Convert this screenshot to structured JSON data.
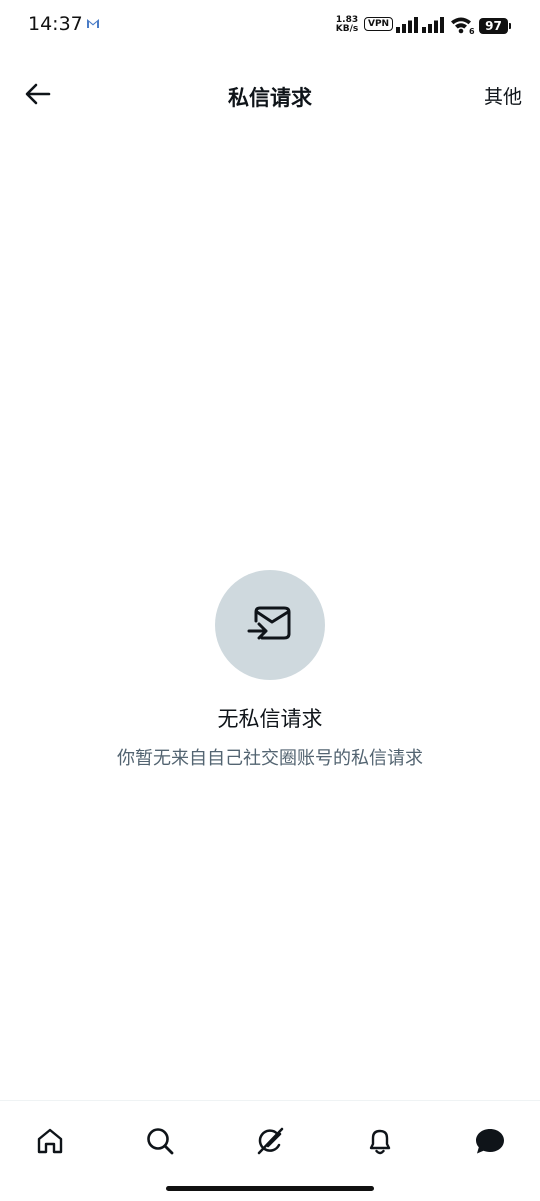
{
  "status_bar": {
    "time": "14:37",
    "net_speed_value": "1.83",
    "net_speed_unit": "KB/s",
    "vpn": "VPN",
    "battery": "97"
  },
  "header": {
    "title": "私信请求",
    "more_label": "其他"
  },
  "empty_state": {
    "title": "无私信请求",
    "subtitle": "你暂无来自自己社交圈账号的私信请求"
  },
  "bottom_nav": {
    "items": [
      "home-icon",
      "search-icon",
      "grok-icon",
      "notifications-icon",
      "messages-icon"
    ],
    "active": "messages-icon"
  },
  "colors": {
    "accent_circle": "#cfd9de",
    "subtitle": "#536471",
    "text": "#0f1419"
  }
}
